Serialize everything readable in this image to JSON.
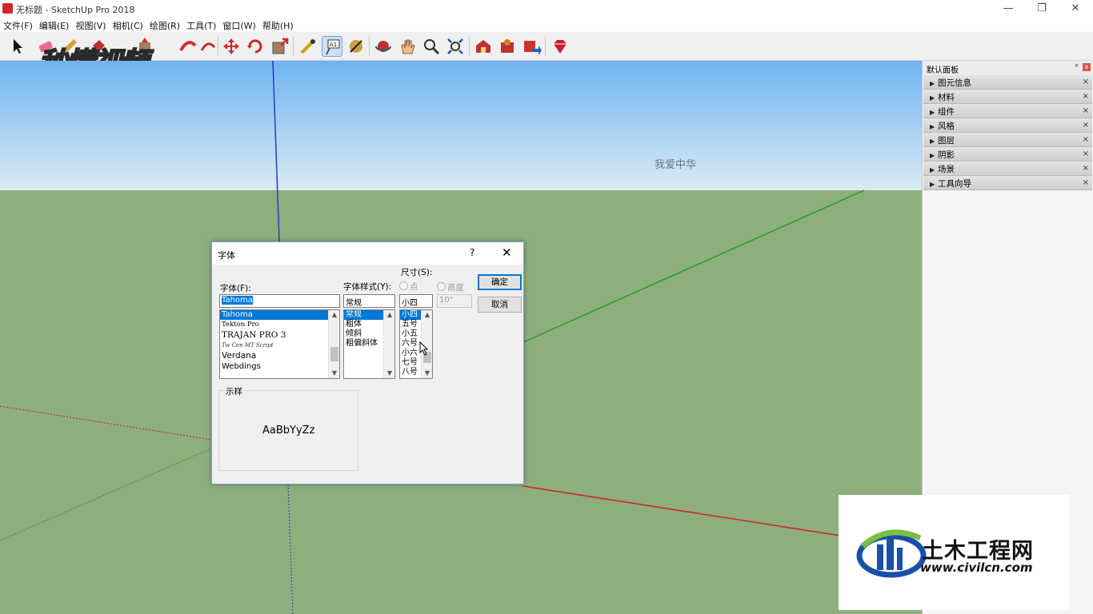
{
  "window": {
    "title": "无标题 - SketchUp Pro 2018",
    "controls": {
      "minimize": "—",
      "restore": "❐",
      "close": "✕"
    }
  },
  "menu": [
    "文件(F)",
    "编辑(E)",
    "视图(V)",
    "相机(C)",
    "绘图(R)",
    "工具(T)",
    "窗口(W)",
    "帮助(H)"
  ],
  "toolbar": {
    "icons": [
      "select-icon",
      "eraser-icon",
      "pencil-icon",
      "paint-bucket-icon",
      "push-pull-icon",
      "follow-me-icon",
      "move-icon",
      "rotate-icon",
      "scale-icon",
      "tape-measure-icon",
      "text-icon",
      "paint-icon",
      "orbit-icon",
      "pan-icon",
      "zoom-icon",
      "zoom-extents-icon",
      "warehouse-icon",
      "components-icon",
      "share-icon",
      "ruby-icon"
    ]
  },
  "watermark_top": "秒懂视频",
  "viewport": {
    "text_label": "我爱中华",
    "colors": {
      "sky_top": "#6fb3ef",
      "sky_bottom": "#dcebf7",
      "ground": "#8fae7e",
      "axis_red": "#d02020",
      "axis_green": "#20a020",
      "axis_blue": "#2040c0"
    }
  },
  "tray": {
    "title": "默认面板",
    "pin": "ᵖ",
    "close": "x",
    "panels": [
      "图元信息",
      "材料",
      "组件",
      "风格",
      "图层",
      "阴影",
      "场景",
      "工具向导"
    ]
  },
  "font_dialog": {
    "title": "字体",
    "help": "?",
    "close": "✕",
    "font_label": "字体(F):",
    "font_value": "Tahoma",
    "fonts": [
      "Tahoma",
      "Tekton Pro",
      "TRAJAN PRO 3",
      "Tw Cen MT Script",
      "Verdana",
      "Webdings"
    ],
    "style_label": "字体样式(Y):",
    "style_value": "常规",
    "styles": [
      "常规",
      "粗体",
      "倾斜",
      "粗偏斜体"
    ],
    "size_label": "尺寸(S):",
    "unit_point": "点",
    "unit_height": "高度",
    "size_value": "小四",
    "height_value": "10\"",
    "sizes": [
      "小四",
      "五号",
      "小五",
      "六号",
      "小六",
      "七号",
      "八号"
    ],
    "ok": "确定",
    "cancel": "取消",
    "sample_legend": "示样",
    "sample_text": "AaBbYyZz"
  },
  "watermark_bottom": {
    "brand": "土木工程网",
    "url": "www.civilcn.com"
  }
}
